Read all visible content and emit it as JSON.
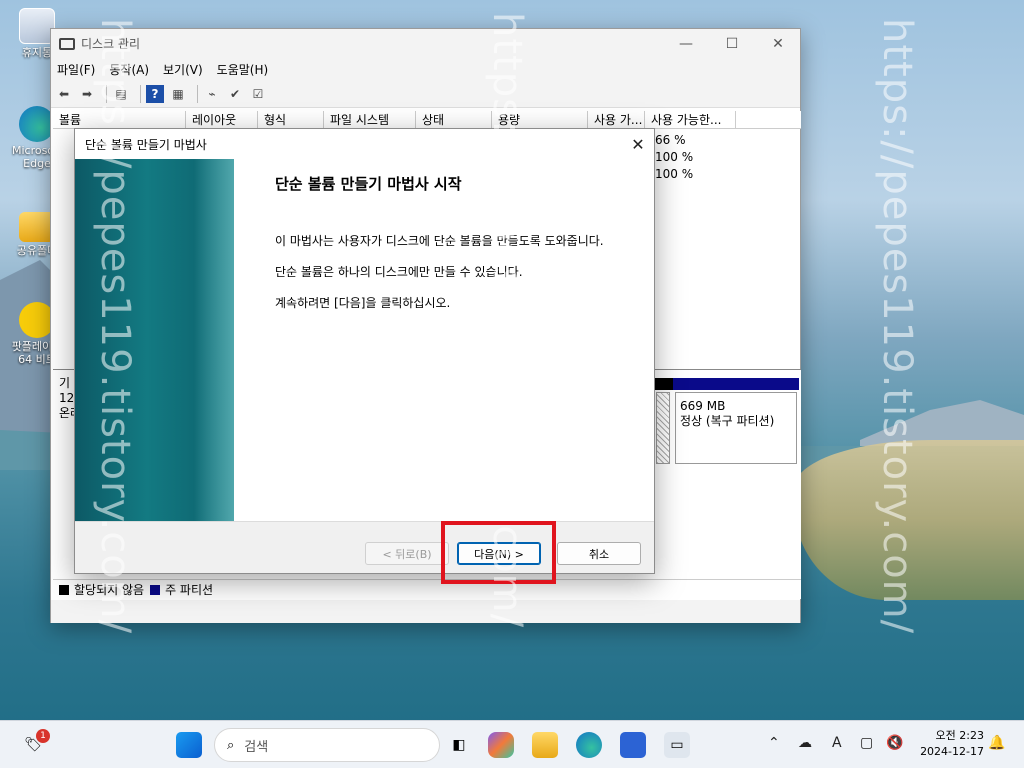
{
  "desktop": {
    "icons": [
      {
        "label": "휴지통"
      },
      {
        "label": "Microsoft Edge"
      },
      {
        "label": "공유폴더"
      },
      {
        "label": "팟플레이어 64 비트"
      }
    ]
  },
  "window": {
    "title": "디스크 관리",
    "menu": [
      "파일(F)",
      "동작(A)",
      "보기(V)",
      "도움말(H)"
    ],
    "columns": [
      "볼륨",
      "레이아웃",
      "형식",
      "파일 시스템",
      "상태",
      "용량",
      "사용 가...",
      "사용 가능한..."
    ],
    "percent_rows": [
      "66 %",
      "100 %",
      "100 %"
    ],
    "disk": {
      "line1": "기",
      "line2": "12",
      "line3": "온라"
    },
    "partition": {
      "size": "669 MB",
      "status": "정상 (복구 파티션)"
    },
    "legend": {
      "unallocated": "할당되지 않음",
      "primary": "주 파티션"
    },
    "colors": {
      "unallocated": "#000000",
      "primary": "#0a0a8a"
    }
  },
  "wizard": {
    "title": "단순 볼륨 만들기 마법사",
    "heading": "단순 볼륨 만들기 마법사 시작",
    "para1": "이 마법사는 사용자가 디스크에 단순 볼륨을 만들도록 도와줍니다.",
    "para2": "단순 볼륨은 하나의 디스크에만 만들 수 있습니다.",
    "para3": "계속하려면 [다음]을 클릭하십시오.",
    "back_label": "< 뒤로(B)",
    "next_label": "다음(N) >",
    "cancel_label": "취소",
    "highlight_color": "#e0141e"
  },
  "watermark": "https://pepes119.tistory.com/",
  "taskbar": {
    "search_placeholder": "검색",
    "notification_badge": "1",
    "ime_label": "A",
    "time": "오전 2:23",
    "date": "2024-12-17"
  }
}
